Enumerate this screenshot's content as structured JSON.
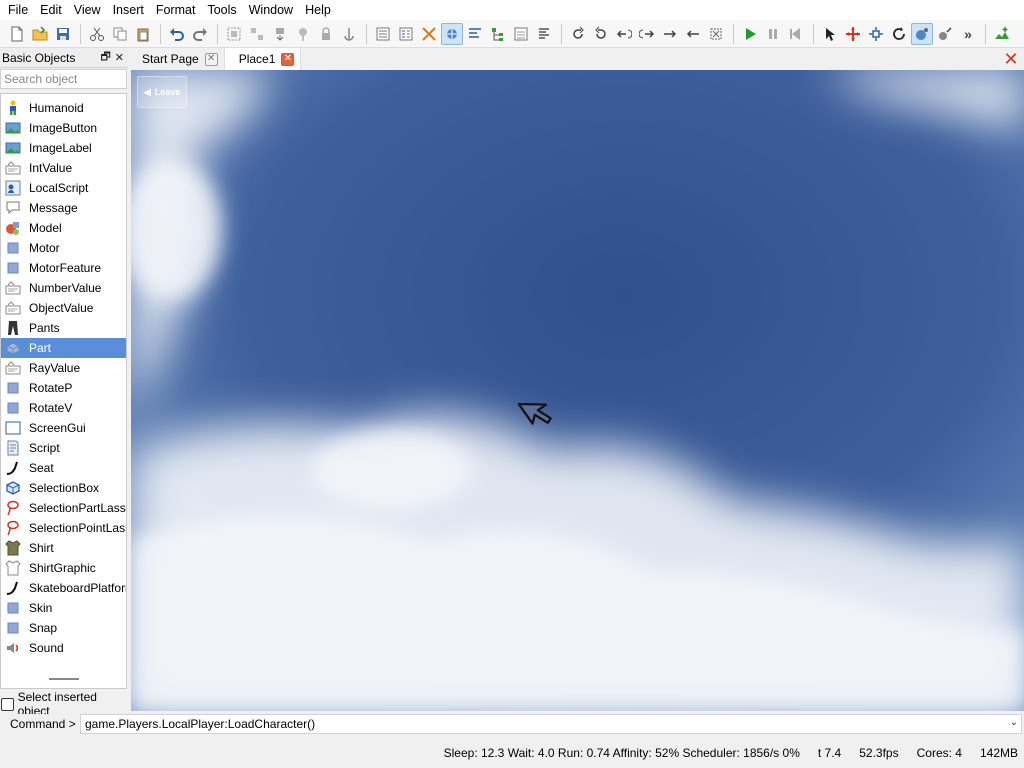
{
  "menu": [
    "File",
    "Edit",
    "View",
    "Insert",
    "Format",
    "Tools",
    "Window",
    "Help"
  ],
  "toolbar": {
    "buttons": [
      "new-file",
      "open-folder",
      "save",
      "cut",
      "copy",
      "paste",
      "undo",
      "redo",
      "group",
      "ungroup",
      "drop",
      "unanchor",
      "lock",
      "anchor",
      "explorer",
      "properties",
      "toolbox",
      "game-explorer",
      "output",
      "hierarchy",
      "object-list",
      "script-editor",
      "rotate-left",
      "rotate-right",
      "tilt-left",
      "tilt-right",
      "move-right",
      "move-left",
      "snap",
      "play",
      "pause",
      "stop",
      "select-tool",
      "move-tool",
      "scale-tool",
      "rotate-tool",
      "camera-tool",
      "paint-tool",
      "overflow",
      "terrain"
    ],
    "overflow_label": "»"
  },
  "left_panel": {
    "title": "Basic Objects",
    "restore_glyph": "🗗",
    "close_glyph": "✕",
    "search_placeholder": "Search object",
    "items": [
      {
        "label": "Humanoid",
        "icon": "humanoid"
      },
      {
        "label": "ImageButton",
        "icon": "image"
      },
      {
        "label": "ImageLabel",
        "icon": "image"
      },
      {
        "label": "IntValue",
        "icon": "value"
      },
      {
        "label": "LocalScript",
        "icon": "localscript"
      },
      {
        "label": "Message",
        "icon": "message"
      },
      {
        "label": "Model",
        "icon": "model"
      },
      {
        "label": "Motor",
        "icon": "square"
      },
      {
        "label": "MotorFeature",
        "icon": "square"
      },
      {
        "label": "NumberValue",
        "icon": "value"
      },
      {
        "label": "ObjectValue",
        "icon": "value"
      },
      {
        "label": "Pants",
        "icon": "pants"
      },
      {
        "label": "Part",
        "icon": "part"
      },
      {
        "label": "RayValue",
        "icon": "value"
      },
      {
        "label": "RotateP",
        "icon": "square"
      },
      {
        "label": "RotateV",
        "icon": "square"
      },
      {
        "label": "ScreenGui",
        "icon": "screengui"
      },
      {
        "label": "Script",
        "icon": "script"
      },
      {
        "label": "Seat",
        "icon": "seat"
      },
      {
        "label": "SelectionBox",
        "icon": "selectionbox"
      },
      {
        "label": "SelectionPartLasso",
        "icon": "lasso"
      },
      {
        "label": "SelectionPointLasso",
        "icon": "lasso"
      },
      {
        "label": "Shirt",
        "icon": "shirt"
      },
      {
        "label": "ShirtGraphic",
        "icon": "shirtgraphic"
      },
      {
        "label": "SkateboardPlatform",
        "icon": "seat"
      },
      {
        "label": "Skin",
        "icon": "square"
      },
      {
        "label": "Snap",
        "icon": "square"
      },
      {
        "label": "Sound",
        "icon": "sound"
      }
    ],
    "selected_index": 12,
    "select_inserted_label": "Select inserted object",
    "select_inserted_checked": false
  },
  "tabs": [
    {
      "label": "Start Page",
      "active": false
    },
    {
      "label": "Place1",
      "active": true
    }
  ],
  "close_glyph": "✕",
  "viewport": {
    "leave_label": "Leave",
    "colors": {
      "sky": "#3e5f9c",
      "cloud": "#e9eef6"
    }
  },
  "command": {
    "label": "Command >",
    "value": "game.Players.LocalPlayer:LoadCharacter()",
    "dropdown_glyph": "⌄"
  },
  "status": [
    "Sleep: 12.3 Wait: 4.0 Run: 0.74 Affinity: 52% Scheduler: 1856/s 0%",
    "t 7.4",
    "52.3fps",
    "Cores: 4",
    "142MB"
  ],
  "colors": {
    "selection": "#5b8ed8",
    "accent_red": "#d3361b",
    "play_green": "#1f9d2c"
  }
}
